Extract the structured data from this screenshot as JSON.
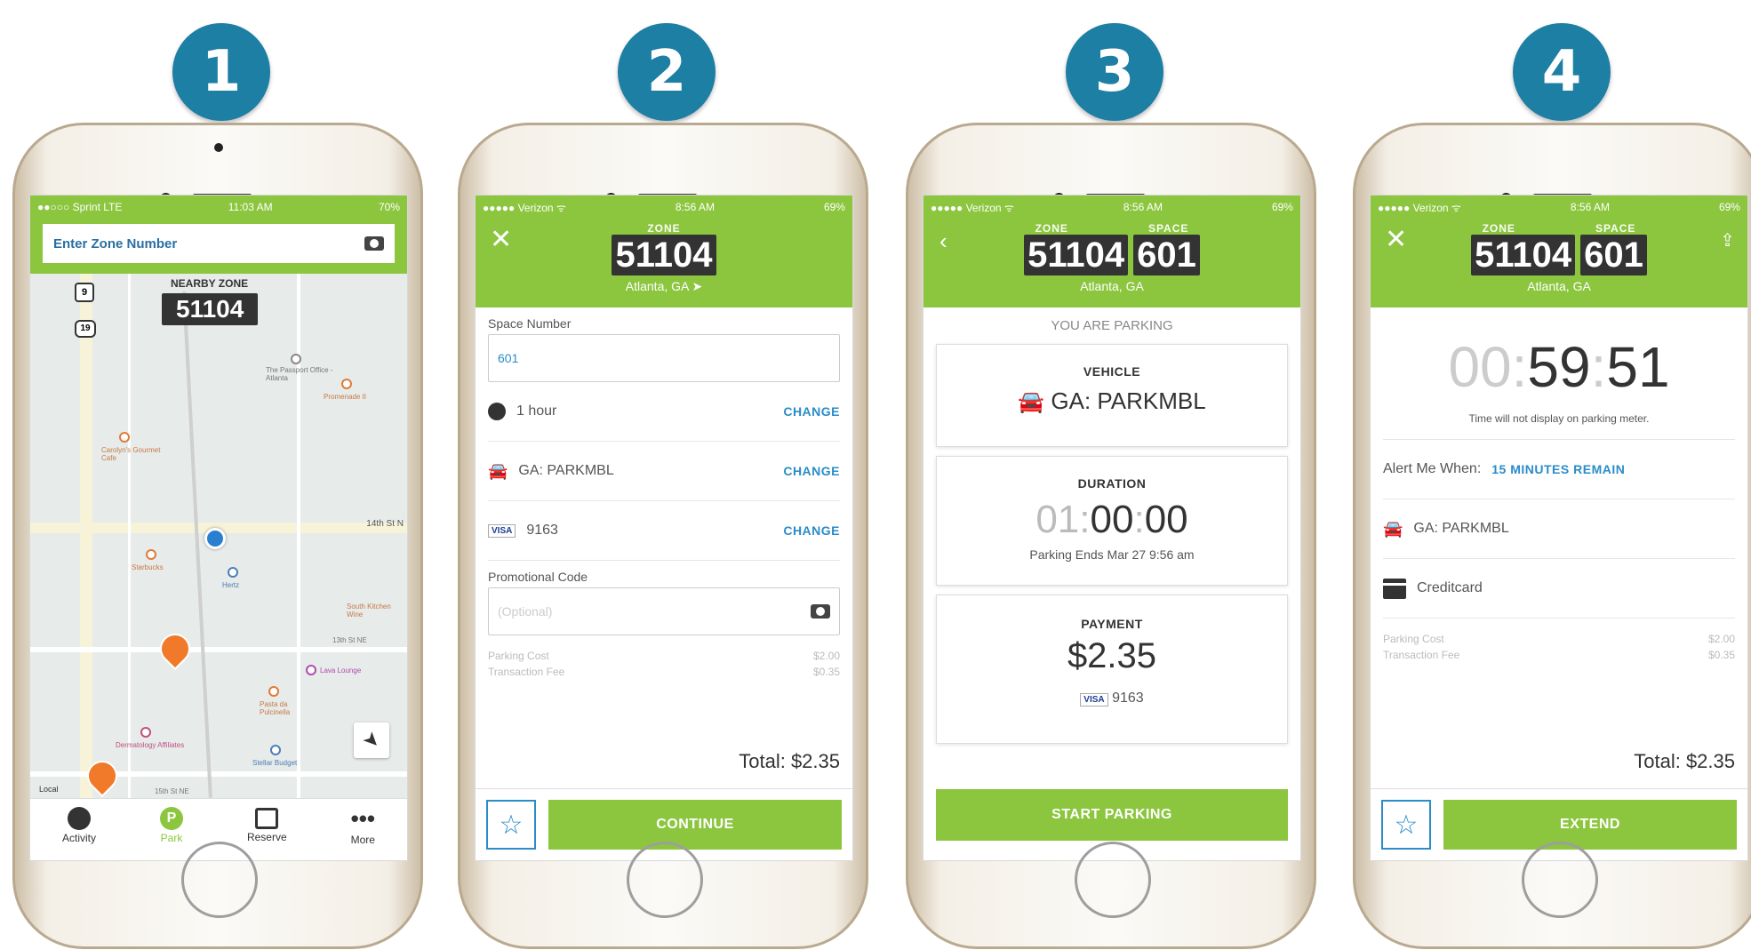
{
  "steps": [
    "1",
    "2",
    "3",
    "4"
  ],
  "colors": {
    "accent": "#8cc63f",
    "link": "#2a8cc9",
    "step": "#1d7fa3",
    "dark_box": "#333333"
  },
  "phone1": {
    "status": {
      "carrier": "●●○○○ Sprint  LTE",
      "time": "11:03 AM",
      "battery": "70%"
    },
    "search": {
      "placeholder": "Enter Zone Number",
      "icon": "camera-icon"
    },
    "nearby_label": "NEARBY ZONE",
    "nearby_zone": "51104",
    "map": {
      "shields": [
        "9",
        "19"
      ],
      "street_label": "14th St N",
      "poi_labels": [
        "The Passport Office - Atlanta",
        "Promenade II",
        "Carolyn's Gourmet Cafe",
        "Starbucks",
        "Hertz",
        "South Kitchen Wine",
        "Lava Lounge",
        "Pasta da Pulcinella",
        "Dermatology Affiliates",
        "Stellar Budget",
        "Local",
        "15th St NE",
        "13th St NE"
      ]
    },
    "tabs": [
      {
        "label": "Activity",
        "icon": "clock-icon"
      },
      {
        "label": "Park",
        "icon": "park-icon"
      },
      {
        "label": "Reserve",
        "icon": "calendar-icon"
      },
      {
        "label": "More",
        "icon": "more-icon"
      }
    ]
  },
  "phone2": {
    "status": {
      "carrier": "●●●●● Verizon ᯤ",
      "time": "8:56 AM",
      "battery": "69%"
    },
    "zone_label": "ZONE",
    "zone": "51104",
    "city": "Atlanta, GA",
    "space_label": "Space Number",
    "space_value": "601",
    "duration": "1 hour",
    "vehicle": "GA: PARKMBL",
    "card_brand": "VISA",
    "card_last4": "9163",
    "change": "CHANGE",
    "promo_label": "Promotional Code",
    "promo_placeholder": "(Optional)",
    "cost_labels": [
      "Parking Cost",
      "Transaction Fee"
    ],
    "cost_values": [
      "$2.00",
      "$0.35"
    ],
    "total": "Total: $2.35",
    "continue": "CONTINUE"
  },
  "phone3": {
    "status": {
      "carrier": "●●●●● Verizon ᯤ",
      "time": "8:56 AM",
      "battery": "69%"
    },
    "zone_label": "ZONE",
    "space_label": "SPACE",
    "zone": "51104",
    "space": "601",
    "city": "Atlanta, GA",
    "you_are_parking": "YOU ARE PARKING",
    "vehicle_title": "VEHICLE",
    "vehicle": "GA: PARKMBL",
    "duration_title": "DURATION",
    "duration_h": "01",
    "duration_m": "00",
    "duration_s": "00",
    "ends": "Parking Ends Mar 27 9:56 am",
    "payment_title": "PAYMENT",
    "amount": "$2.35",
    "card_brand": "VISA",
    "card_last4": "9163",
    "start": "START PARKING"
  },
  "phone4": {
    "status": {
      "carrier": "●●●●● Verizon ᯤ",
      "time": "8:56 AM",
      "battery": "69%"
    },
    "zone_label": "ZONE",
    "space_label": "SPACE",
    "zone": "51104",
    "space": "601",
    "city": "Atlanta, GA",
    "timer_h": "00",
    "timer_m": "59",
    "timer_s": "51",
    "note": "Time will not display on parking meter.",
    "alert_label": "Alert Me When:",
    "alert_value": "15 MINUTES REMAIN",
    "vehicle": "GA: PARKMBL",
    "payment": "Creditcard",
    "cost_labels": [
      "Parking Cost",
      "Transaction Fee"
    ],
    "cost_values": [
      "$2.00",
      "$0.35"
    ],
    "total": "Total: $2.35",
    "extend": "EXTEND"
  }
}
